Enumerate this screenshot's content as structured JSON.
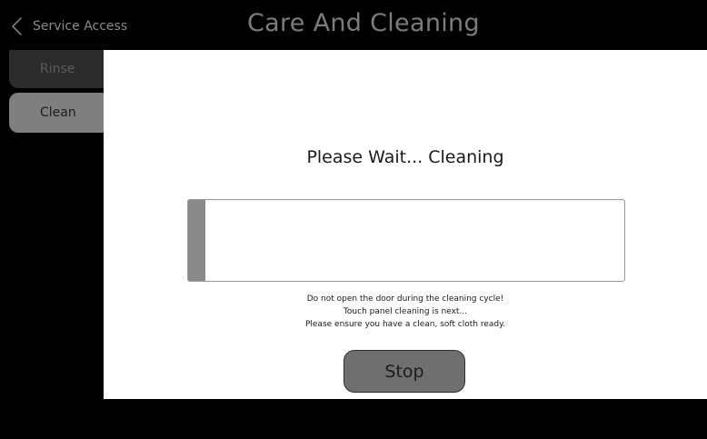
{
  "header": {
    "back_label": "Service Access",
    "title": "Care And Cleaning"
  },
  "sidebar": {
    "items": [
      {
        "label": "Rinse",
        "selected": false
      },
      {
        "label": "Clean",
        "selected": true
      }
    ]
  },
  "main": {
    "status_title": "Please Wait... Cleaning",
    "progress_fraction": 0.04,
    "instructions": [
      "Do not open the door during the cleaning cycle!",
      "Touch panel cleaning is next...",
      "Please ensure you have a clean, soft cloth ready."
    ],
    "stop_label": "Stop"
  },
  "colors": {
    "background": "#000000",
    "panel": "#ffffff",
    "selected_tab": "#7f7f7f",
    "unselected_tab": "#2b2b2b",
    "progress_fill": "#8a8a8a",
    "stop_button": "#6f6f6f"
  },
  "icons": {
    "back": "chevron-left-icon"
  }
}
